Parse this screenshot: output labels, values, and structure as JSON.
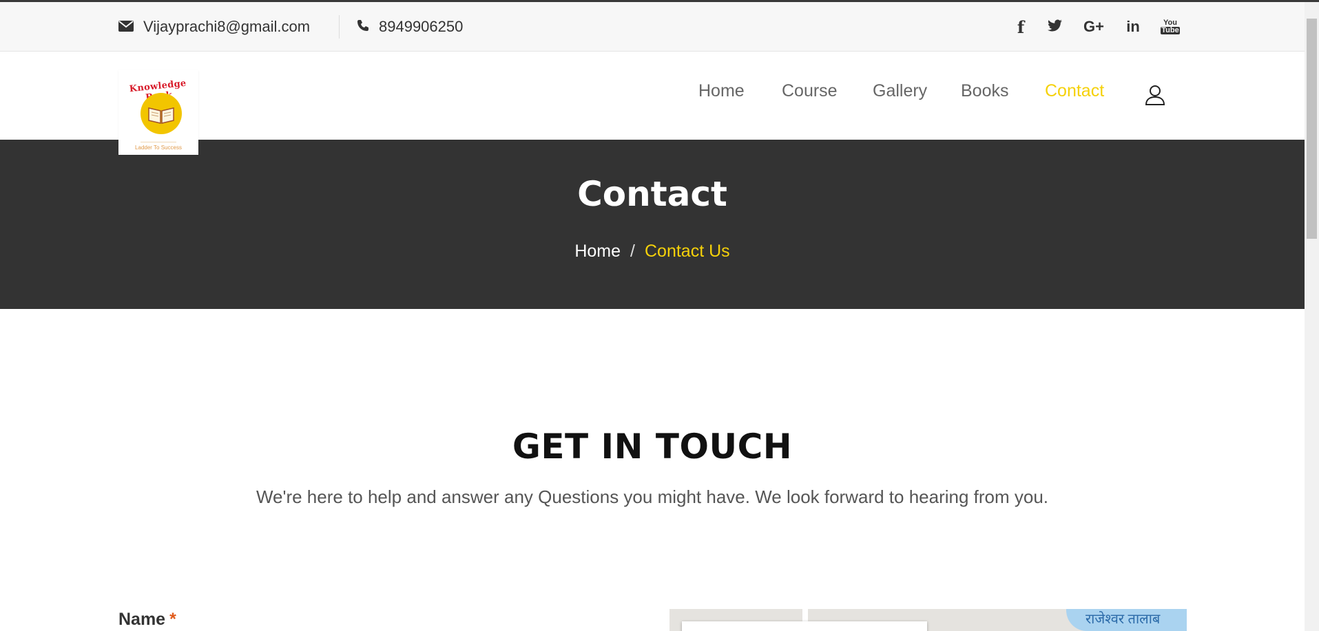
{
  "topbar": {
    "email": "Vijayprachi8@gmail.com",
    "phone": "8949906250",
    "social": [
      "facebook-icon",
      "twitter-icon",
      "google-plus-icon",
      "linkedin-icon",
      "youtube-icon"
    ],
    "social_glyphs": {
      "facebook": "f",
      "googleplus": "G+",
      "linkedin": "in",
      "youtube_top": "You",
      "youtube_bottom": "Tube"
    }
  },
  "logo": {
    "brand": "Knowledge Bank",
    "tagline": "Ladder To Success"
  },
  "nav": {
    "items": [
      {
        "label": "Home"
      },
      {
        "label": "Course"
      },
      {
        "label": "Gallery"
      },
      {
        "label": "Books"
      },
      {
        "label": "Contact"
      }
    ],
    "active": "Contact"
  },
  "banner": {
    "title": "Contact",
    "breadcrumb": {
      "home": "Home",
      "separator": "/",
      "current": "Contact Us"
    }
  },
  "section": {
    "title": "GET IN TOUCH",
    "text": "We're here to help and answer any Questions you might have. We look forward to hearing from you."
  },
  "form": {
    "name_label": "Name",
    "required_mark": "*"
  },
  "map": {
    "label": "राजेश्वर तालाब"
  },
  "colors": {
    "accent": "#f5d10a",
    "banner": "#333333",
    "topbar": "#f7f7f7"
  }
}
